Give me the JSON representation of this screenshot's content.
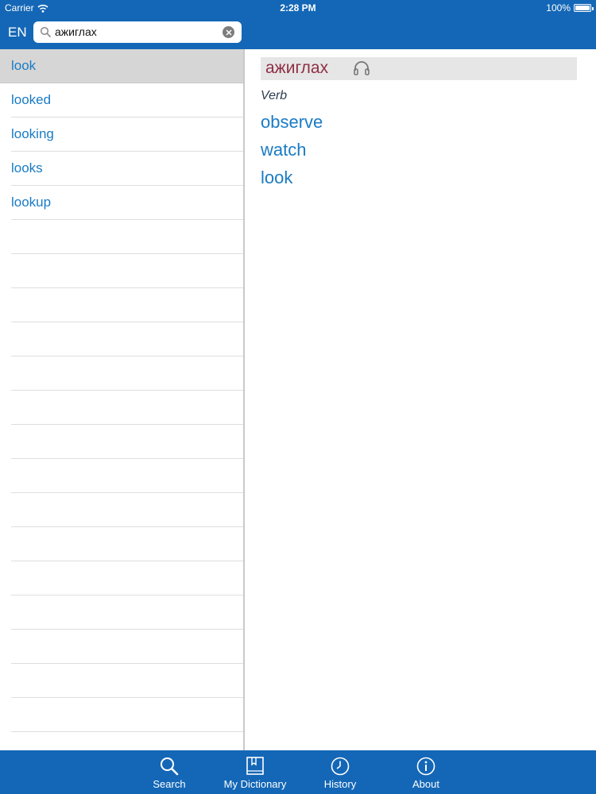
{
  "status_bar": {
    "carrier": "Carrier",
    "time": "2:28 PM",
    "battery": "100%"
  },
  "search": {
    "language": "EN",
    "query": "ажиглах"
  },
  "results": [
    {
      "label": "look"
    },
    {
      "label": "looked"
    },
    {
      "label": "looking"
    },
    {
      "label": "looks"
    },
    {
      "label": "lookup"
    }
  ],
  "entry": {
    "headword": "ажиглах",
    "part_of_speech": "Verb",
    "translations": [
      "observe",
      "watch",
      "look"
    ]
  },
  "tabs": [
    {
      "label": "Search",
      "icon": "magnifier-icon"
    },
    {
      "label": "My Dictionary",
      "icon": "book-icon"
    },
    {
      "label": "History",
      "icon": "clock-icon"
    },
    {
      "label": "About",
      "icon": "info-icon"
    }
  ],
  "colors": {
    "bar_blue": "#1467b6",
    "link_blue": "#1a7bc4",
    "headword_red": "#8e2f45",
    "selected_row": "#d6d6d6"
  }
}
